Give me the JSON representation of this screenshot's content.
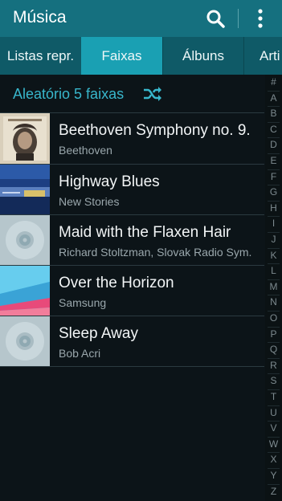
{
  "appbar": {
    "title": "Música",
    "icons": [
      "search-icon",
      "more-vert-icon"
    ]
  },
  "tabs": [
    {
      "label": "Listas repr.",
      "active": false
    },
    {
      "label": "Faixas",
      "active": true
    },
    {
      "label": "Álbuns",
      "active": false
    },
    {
      "label": "Arti",
      "active": false
    }
  ],
  "shuffle": {
    "label": "Aleatório 5 faixas",
    "icon": "shuffle-icon"
  },
  "tracks": [
    {
      "title": "Beethoven Symphony no. 9.",
      "artist": "Beethoven",
      "art": "beethoven-cover"
    },
    {
      "title": "Highway Blues",
      "artist": "New Stories",
      "art": "highway-cover"
    },
    {
      "title": "Maid with the Flaxen Hair",
      "artist": "Richard Stoltzman, Slovak Radio Sym.",
      "art": "cd-placeholder"
    },
    {
      "title": "Over the Horizon",
      "artist": "Samsung",
      "art": "horizon-cover"
    },
    {
      "title": "Sleep Away",
      "artist": "Bob Acri",
      "art": "cd-placeholder"
    }
  ],
  "index_letters": [
    "#",
    "A",
    "B",
    "C",
    "D",
    "E",
    "F",
    "G",
    "H",
    "I",
    "J",
    "K",
    "L",
    "M",
    "N",
    "O",
    "P",
    "Q",
    "R",
    "S",
    "T",
    "U",
    "V",
    "W",
    "X",
    "Y",
    "Z"
  ],
  "colors": {
    "appbar": "#15707f",
    "tabbar": "#0f5a67",
    "active_tab": "#1aa0b3",
    "accent_text": "#38b7cc",
    "background": "#0c1418"
  }
}
